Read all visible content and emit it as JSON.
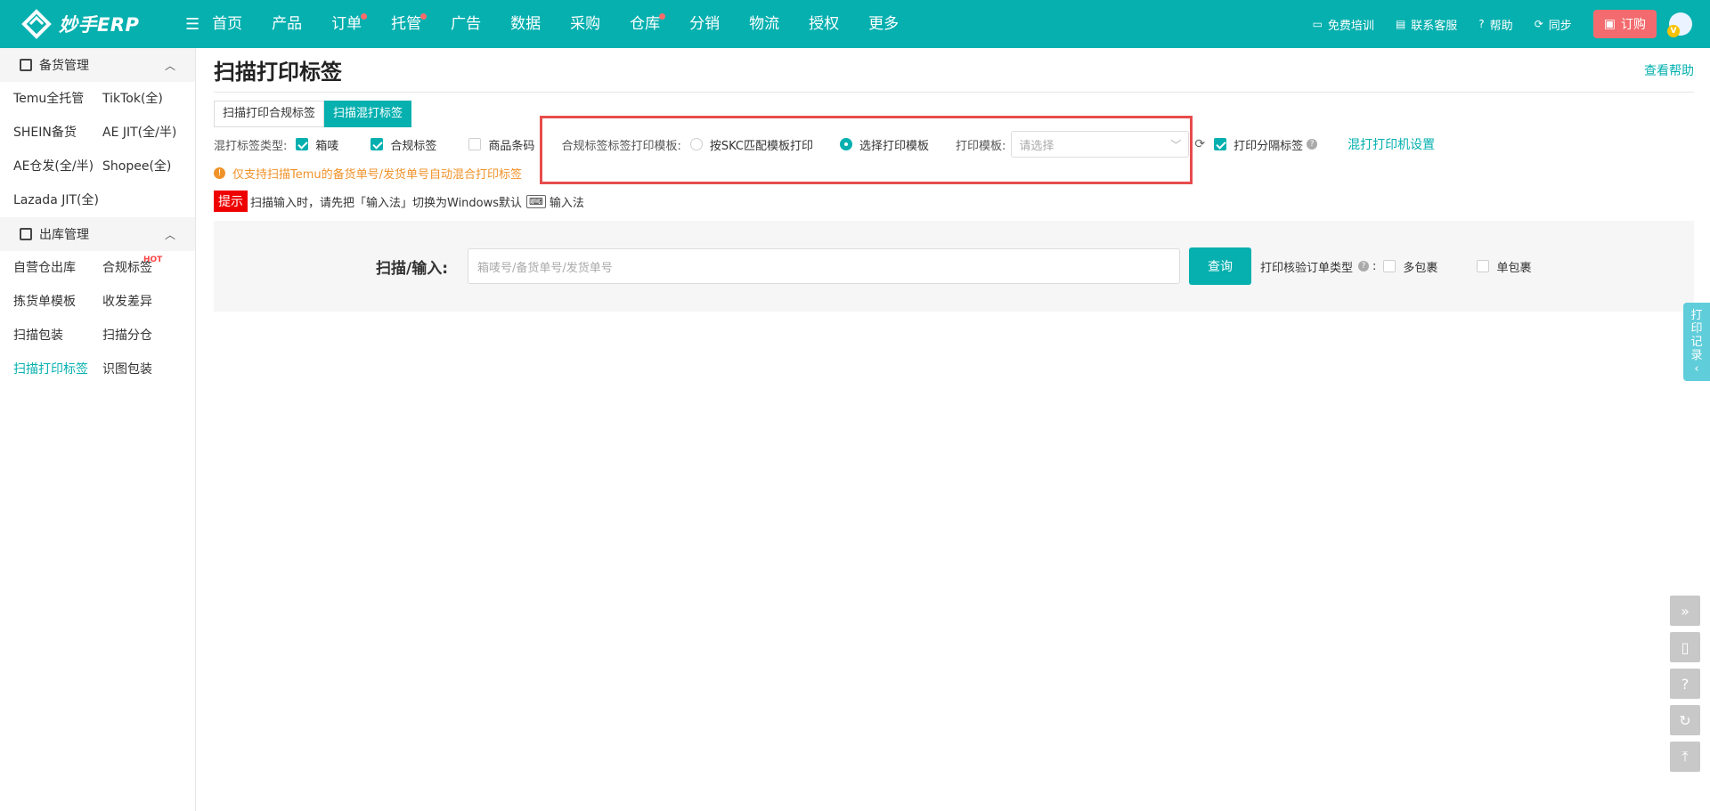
{
  "brand": {
    "name": "妙手ERP",
    "accent": "#05b0af"
  },
  "nav": {
    "items": [
      {
        "label": "首页",
        "dot": false
      },
      {
        "label": "产品",
        "dot": false
      },
      {
        "label": "订单",
        "dot": true
      },
      {
        "label": "托管",
        "dot": true
      },
      {
        "label": "广告",
        "dot": false
      },
      {
        "label": "数据",
        "dot": false
      },
      {
        "label": "采购",
        "dot": false
      },
      {
        "label": "仓库",
        "dot": true
      },
      {
        "label": "分销",
        "dot": false
      },
      {
        "label": "物流",
        "dot": false
      },
      {
        "label": "授权",
        "dot": false
      },
      {
        "label": "更多",
        "dot": false
      }
    ],
    "right": {
      "training": "免费培训",
      "support": "联系客服",
      "help": "帮助",
      "sync": "同步",
      "order": "订购",
      "vip_badge": "V"
    }
  },
  "sidebar": {
    "group1": {
      "title": "备货管理",
      "items": [
        "Temu全托管",
        "TikTok(全)",
        "SHEIN备货",
        "AE JIT(全/半)",
        "AE仓发(全/半)",
        "Shopee(全)",
        "Lazada JIT(全)"
      ]
    },
    "group2": {
      "title": "出库管理",
      "items": [
        "自营仓出库",
        "合规标签",
        "拣货单模板",
        "收发差异",
        "扫描包装",
        "扫描分仓",
        "扫描打印标签",
        "识图包装"
      ],
      "hot": "HOT",
      "active": "扫描打印标签"
    }
  },
  "page": {
    "title": "扫描打印标签",
    "help_link": "查看帮助",
    "tabs": [
      "扫描打印合规标签",
      "扫描混打标签"
    ],
    "active_tab": "扫描混打标签",
    "mix": {
      "label": "混打标签类型:",
      "options": [
        {
          "label": "箱唛",
          "checked": true
        },
        {
          "label": "合规标签",
          "checked": true
        },
        {
          "label": "商品条码",
          "checked": false
        }
      ]
    },
    "template": {
      "label": "合规标签标签打印模板:",
      "radio1": "按SKC匹配模板打印",
      "radio2": "选择打印模板",
      "selected": "选择打印模板",
      "print_label": "打印模板:",
      "select_placeholder": "请选择"
    },
    "separator": {
      "label": "打印分隔标签",
      "checked": true
    },
    "printer_settings": "混打打印机设置",
    "notice": "仅支持扫描Temu的备货单号/发货单号自动混合打印标签",
    "tip": {
      "badge": "提示",
      "text": "扫描输入时，请先把「输入法」切换为Windows默认",
      "ime": "输入法"
    },
    "scan": {
      "label": "扫描/输入:",
      "placeholder": "箱唛号/备货单号/发货单号",
      "button": "查询",
      "verify_label": "打印核验订单类型",
      "colon": ":",
      "opt1": "多包裹",
      "opt2": "单包裹"
    }
  },
  "floating": {
    "print_record": [
      "打",
      "印",
      "记",
      "录"
    ],
    "print_record_arrow": "‹"
  }
}
